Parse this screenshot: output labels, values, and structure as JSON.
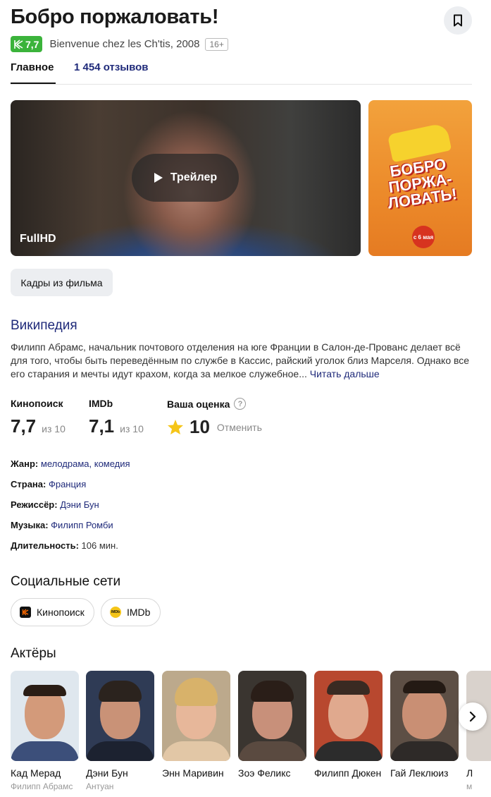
{
  "movie": {
    "title": "Бобро поржаловать!",
    "kp_rating": "7,7",
    "original_title_year": "Bienvenue chez les Ch'tis, 2008",
    "age_rating": "16+"
  },
  "tabs": [
    {
      "label": "Главное",
      "active": true
    },
    {
      "label": "1 454 отзывов",
      "active": false
    }
  ],
  "media": {
    "trailer_label": "Трейлер",
    "quality_badge": "FullHD",
    "poster_text": "БОБРО ПОРЖА-ЛОВАТЬ!",
    "poster_date": "с 6 мая",
    "stills_button": "Кадры из фильма"
  },
  "wiki": {
    "title": "Википедия",
    "text": "Филипп Абрамс, начальник почтового отделения на юге Франции в Салон-де-Прованс делает всё для того, чтобы быть переведённым по службе в Кассис, райский уголок близ Марселя. Однако все его старания и мечты идут крахом, когда за мелкое служебное...",
    "read_more": "Читать дальше"
  },
  "ratings": {
    "kinopoisk": {
      "label": "Кинопоиск",
      "value": "7,7",
      "of": "из 10"
    },
    "imdb": {
      "label": "IMDb",
      "value": "7,1",
      "of": "из 10"
    },
    "yours": {
      "label": "Ваша оценка",
      "value": "10",
      "cancel": "Отменить"
    }
  },
  "facts": [
    {
      "label": "Жанр:",
      "value": "мелодрама, комедия",
      "link": true
    },
    {
      "label": "Страна:",
      "value": "Франция",
      "link": true
    },
    {
      "label": "Режиссёр:",
      "value": "Дэни Бун",
      "link": true
    },
    {
      "label": "Музыка:",
      "value": "Филипп Ромби",
      "link": true
    },
    {
      "label": "Длительность:",
      "value": "106 мин.",
      "link": false
    }
  ],
  "social": {
    "title": "Социальные сети",
    "kinopoisk": "Кинопоиск",
    "imdb": "IMDb"
  },
  "actors": {
    "title": "Актёры",
    "items": [
      {
        "name": "Кад Мерад",
        "role": "Филипп Абрамс"
      },
      {
        "name": "Дэни Бун",
        "role": "Антуан"
      },
      {
        "name": "Энн Маривин",
        "role": ""
      },
      {
        "name": "Зоэ Феликс",
        "role": ""
      },
      {
        "name": "Филипп Дюкен",
        "role": ""
      },
      {
        "name": "Гай Леклюиз",
        "role": ""
      },
      {
        "name": "Л",
        "role": "м"
      }
    ]
  },
  "icons": {
    "bookmark": "bookmark-icon",
    "play": "play-icon",
    "star": "star-icon",
    "help": "help-icon",
    "next": "chevron-right-icon"
  },
  "colors": {
    "accent_link": "#1f2a7a",
    "kp_green": "#3bb33b",
    "star": "#f5c518"
  }
}
